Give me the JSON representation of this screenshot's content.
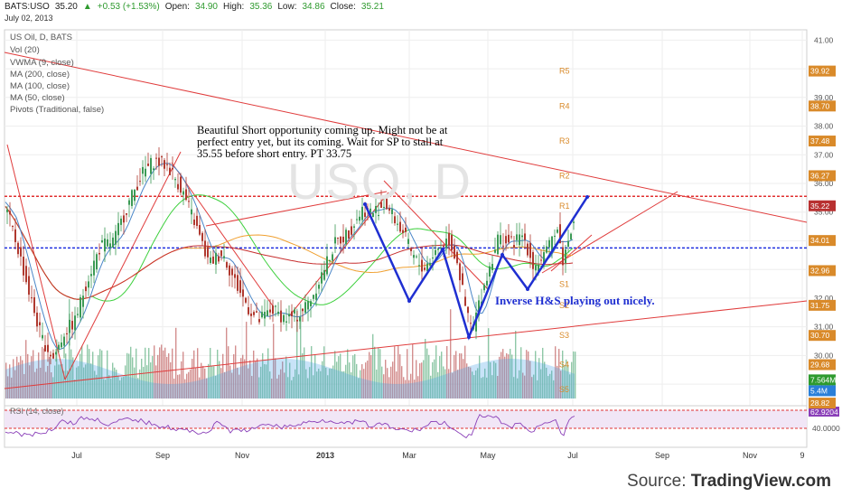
{
  "header": {
    "symbol": "BATS:USO",
    "last": "35.20",
    "change": "+0.53 (+1.53%)",
    "open_label": "Open:",
    "open": "34.90",
    "high_label": "High:",
    "high": "35.36",
    "low_label": "Low:",
    "low": "34.86",
    "close_label": "Close:",
    "close": "35.21",
    "date": "July 02, 2013"
  },
  "indicators": [
    "US Oil, D, BATS",
    "Vol (20)",
    "VWMA (9, close)",
    "MA (200, close)",
    "MA (100, close)",
    "MA (50, close)",
    "Pivots (Traditional, false)"
  ],
  "annotation": "Beautiful Short opportunity coming up. Might not be at perfect entry yet, but its coming.  Wait for SP to stall at 35.55 before short entry.  PT 33.75",
  "hs_label": "Inverse H&S playing out nicely.",
  "watermark": "USO, D",
  "source": {
    "prefix": "Source: ",
    "brand": "TradingView.com"
  },
  "colors": {
    "up": "#3c9a55",
    "down": "#b0392f",
    "trendline": "#e03c3c",
    "hs": "#1f2fd1",
    "ma50": "#3dd03d",
    "ma100": "#f0a030",
    "ma200": "#c72f2f",
    "vwma": "#4a86c8",
    "rsi": "#8a3fb8",
    "pivot": "#d98a2a"
  },
  "chart_data": {
    "type": "candlestick",
    "price_axis": {
      "ticks": [
        "41.00",
        "40.00",
        "39.00",
        "38.00",
        "37.00",
        "36.00",
        "35.00",
        "34.00",
        "33.00",
        "32.00",
        "31.00",
        "30.00",
        "29.00"
      ],
      "range": [
        28.5,
        41.2
      ]
    },
    "time_axis": {
      "ticks": [
        "Jul",
        "Sep",
        "Nov",
        "2013",
        "Mar",
        "May",
        "Jul",
        "Sep",
        "Nov",
        "9"
      ]
    },
    "price_labels": [
      {
        "text": "39.92",
        "v": 39.92,
        "color": "#d98a2a"
      },
      {
        "text": "38.70",
        "v": 38.7,
        "color": "#d98a2a"
      },
      {
        "text": "37.48",
        "v": 37.48,
        "color": "#d98a2a"
      },
      {
        "text": "36.27",
        "v": 36.27,
        "color": "#d98a2a"
      },
      {
        "text": "35.22",
        "v": 35.22,
        "color": "#b83030"
      },
      {
        "text": "34.01",
        "v": 34.01,
        "color": "#d98a2a"
      },
      {
        "text": "32.96",
        "v": 32.96,
        "color": "#d98a2a"
      },
      {
        "text": "31.75",
        "v": 31.75,
        "color": "#d98a2a"
      },
      {
        "text": "30.70",
        "v": 30.7,
        "color": "#d98a2a"
      },
      {
        "text": "29.68",
        "v": 29.68,
        "color": "#d98a2a"
      },
      {
        "text": "7.564M",
        "v": 29.15,
        "color": "#2e9a2e"
      },
      {
        "text": "5.4M",
        "v": 28.77,
        "color": "#2a7fd8"
      },
      {
        "text": "28.82",
        "v": 28.34,
        "color": "#d98a2a"
      }
    ],
    "pivots": [
      {
        "name": "R5",
        "v": 39.92
      },
      {
        "name": "R4",
        "v": 38.7
      },
      {
        "name": "R3",
        "v": 37.48
      },
      {
        "name": "R2",
        "v": 36.27
      },
      {
        "name": "R1",
        "v": 35.22
      },
      {
        "name": "P",
        "v": 34.01
      },
      {
        "name": "S1",
        "v": 32.96
      },
      {
        "name": "S2",
        "v": 31.75
      },
      {
        "name": "S3",
        "v": 30.7
      },
      {
        "name": "S4",
        "v": 29.68
      },
      {
        "name": "S5",
        "v": 28.82
      }
    ],
    "levels": {
      "red_dotted": 35.55,
      "blue_dotted": 33.75
    },
    "close_path": [
      [
        0,
        35.5
      ],
      [
        8,
        34.9
      ],
      [
        20,
        33.6
      ],
      [
        32,
        32.1
      ],
      [
        45,
        30.6
      ],
      [
        58,
        29.9
      ],
      [
        70,
        30.8
      ],
      [
        82,
        31.2
      ],
      [
        95,
        32.6
      ],
      [
        110,
        33.8
      ],
      [
        125,
        34.0
      ],
      [
        140,
        35.2
      ],
      [
        155,
        36.3
      ],
      [
        170,
        36.8
      ],
      [
        185,
        36.6
      ],
      [
        200,
        35.8
      ],
      [
        215,
        34.6
      ],
      [
        230,
        33.2
      ],
      [
        245,
        33.6
      ],
      [
        260,
        32.5
      ],
      [
        275,
        31.6
      ],
      [
        285,
        31.2
      ],
      [
        300,
        31.6
      ],
      [
        315,
        31.3
      ],
      [
        330,
        31.4
      ],
      [
        345,
        32.1
      ],
      [
        360,
        33.2
      ],
      [
        370,
        33.9
      ],
      [
        385,
        34.3
      ],
      [
        400,
        35.1
      ],
      [
        412,
        35.0
      ],
      [
        425,
        35.3
      ],
      [
        435,
        34.8
      ],
      [
        445,
        34.3
      ],
      [
        455,
        33.5
      ],
      [
        468,
        33.0
      ],
      [
        480,
        33.6
      ],
      [
        495,
        34.1
      ],
      [
        505,
        33.3
      ],
      [
        515,
        31.5
      ],
      [
        522,
        30.9
      ],
      [
        530,
        31.9
      ],
      [
        540,
        33.0
      ],
      [
        550,
        34.1
      ],
      [
        565,
        33.9
      ],
      [
        578,
        34.2
      ],
      [
        590,
        33.1
      ],
      [
        605,
        33.6
      ],
      [
        615,
        34.6
      ],
      [
        622,
        33.3
      ],
      [
        628,
        34.0
      ],
      [
        636,
        35.2
      ]
    ],
    "rsi": {
      "label": "RSI (14, close)",
      "value": "62.9204",
      "bounds": [
        30,
        70
      ],
      "level_label": "40.0000"
    }
  }
}
